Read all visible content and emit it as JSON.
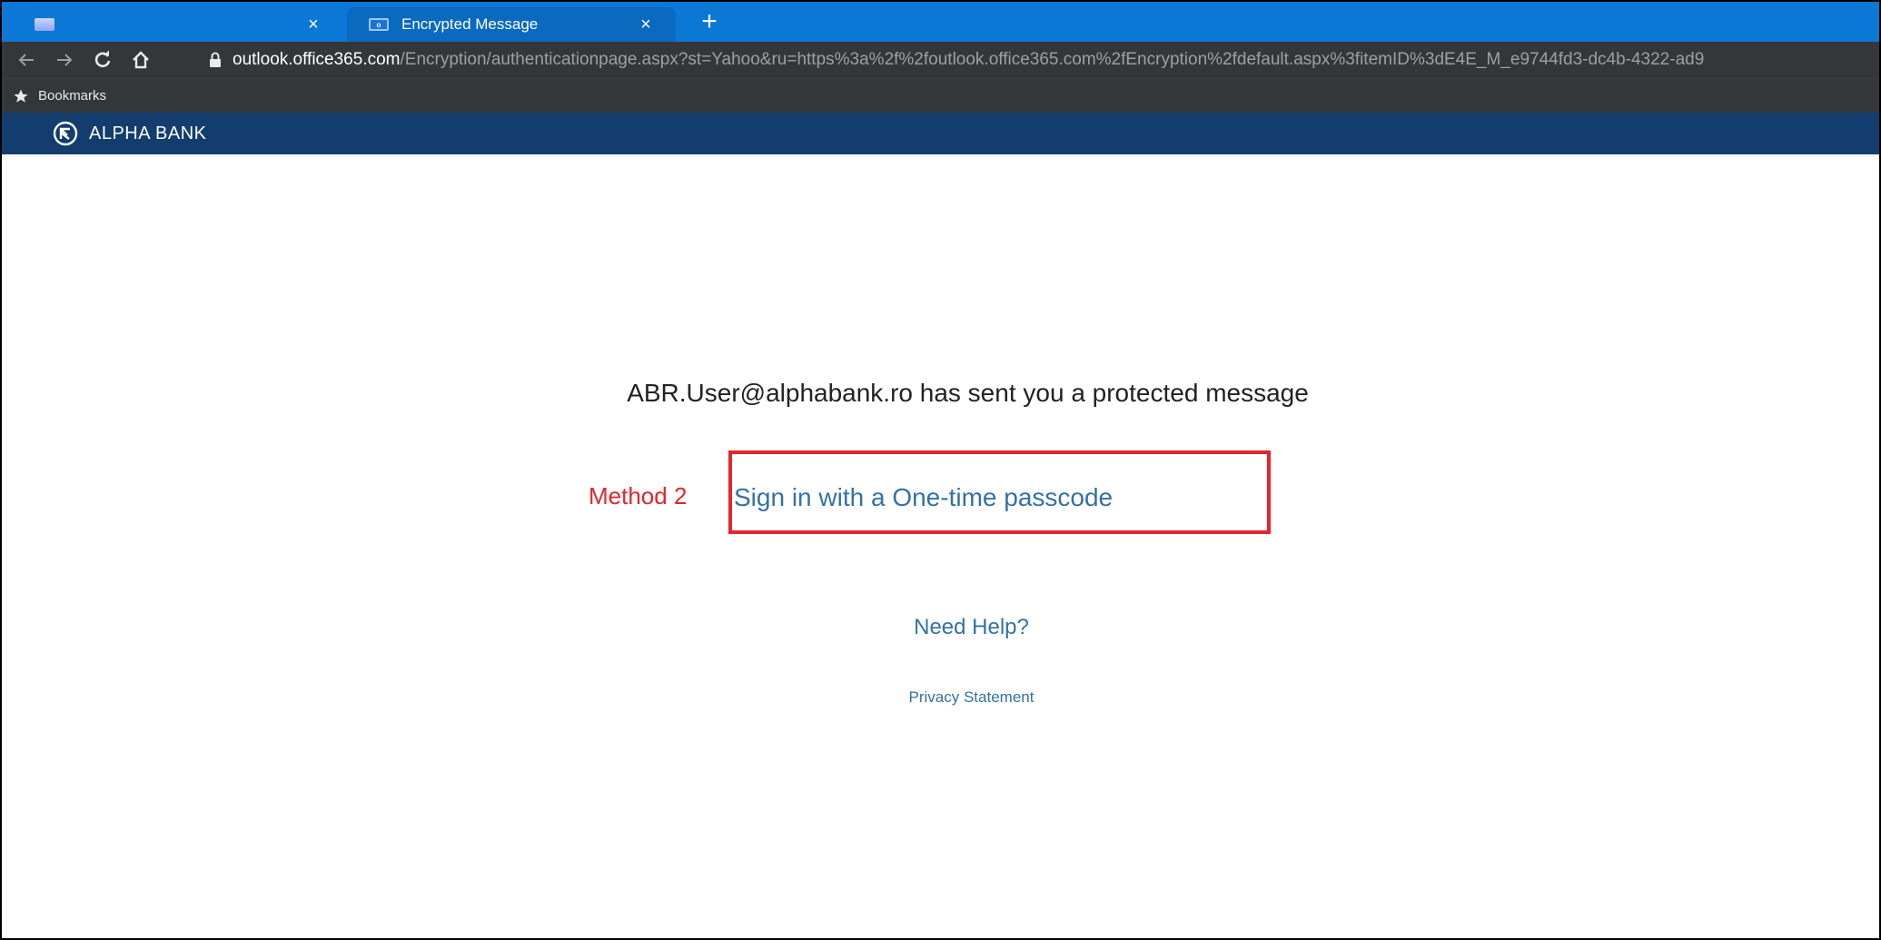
{
  "browser": {
    "tabs": [
      {
        "title": "",
        "close_glyph": "×"
      },
      {
        "title": "Encrypted Message",
        "close_glyph": "×"
      }
    ],
    "new_tab_glyph": "+",
    "url_host": "outlook.office365.com",
    "url_path": "/Encryption/authenticationpage.aspx?st=Yahoo&ru=https%3a%2f%2foutlook.office365.com%2fEncryption%2fdefault.aspx%3fitemID%3dE4E_M_e9744fd3-dc4b-4322-ad9",
    "bookmarks_label": "Bookmarks",
    "colors": {
      "tabstrip": "#0a78d4",
      "toolbar": "#35363a"
    }
  },
  "bank": {
    "name": "ALPHA BANK",
    "header_color": "#133d6e"
  },
  "page": {
    "sender_message": "ABR.User@alphabank.ro has sent you a protected message",
    "method_label": "Method 2",
    "otp_link": "Sign in with a One-time passcode",
    "help_link": "Need Help?",
    "privacy_link": "Privacy Statement",
    "link_color": "#3471a6",
    "annotation_color": "#e1262c"
  }
}
